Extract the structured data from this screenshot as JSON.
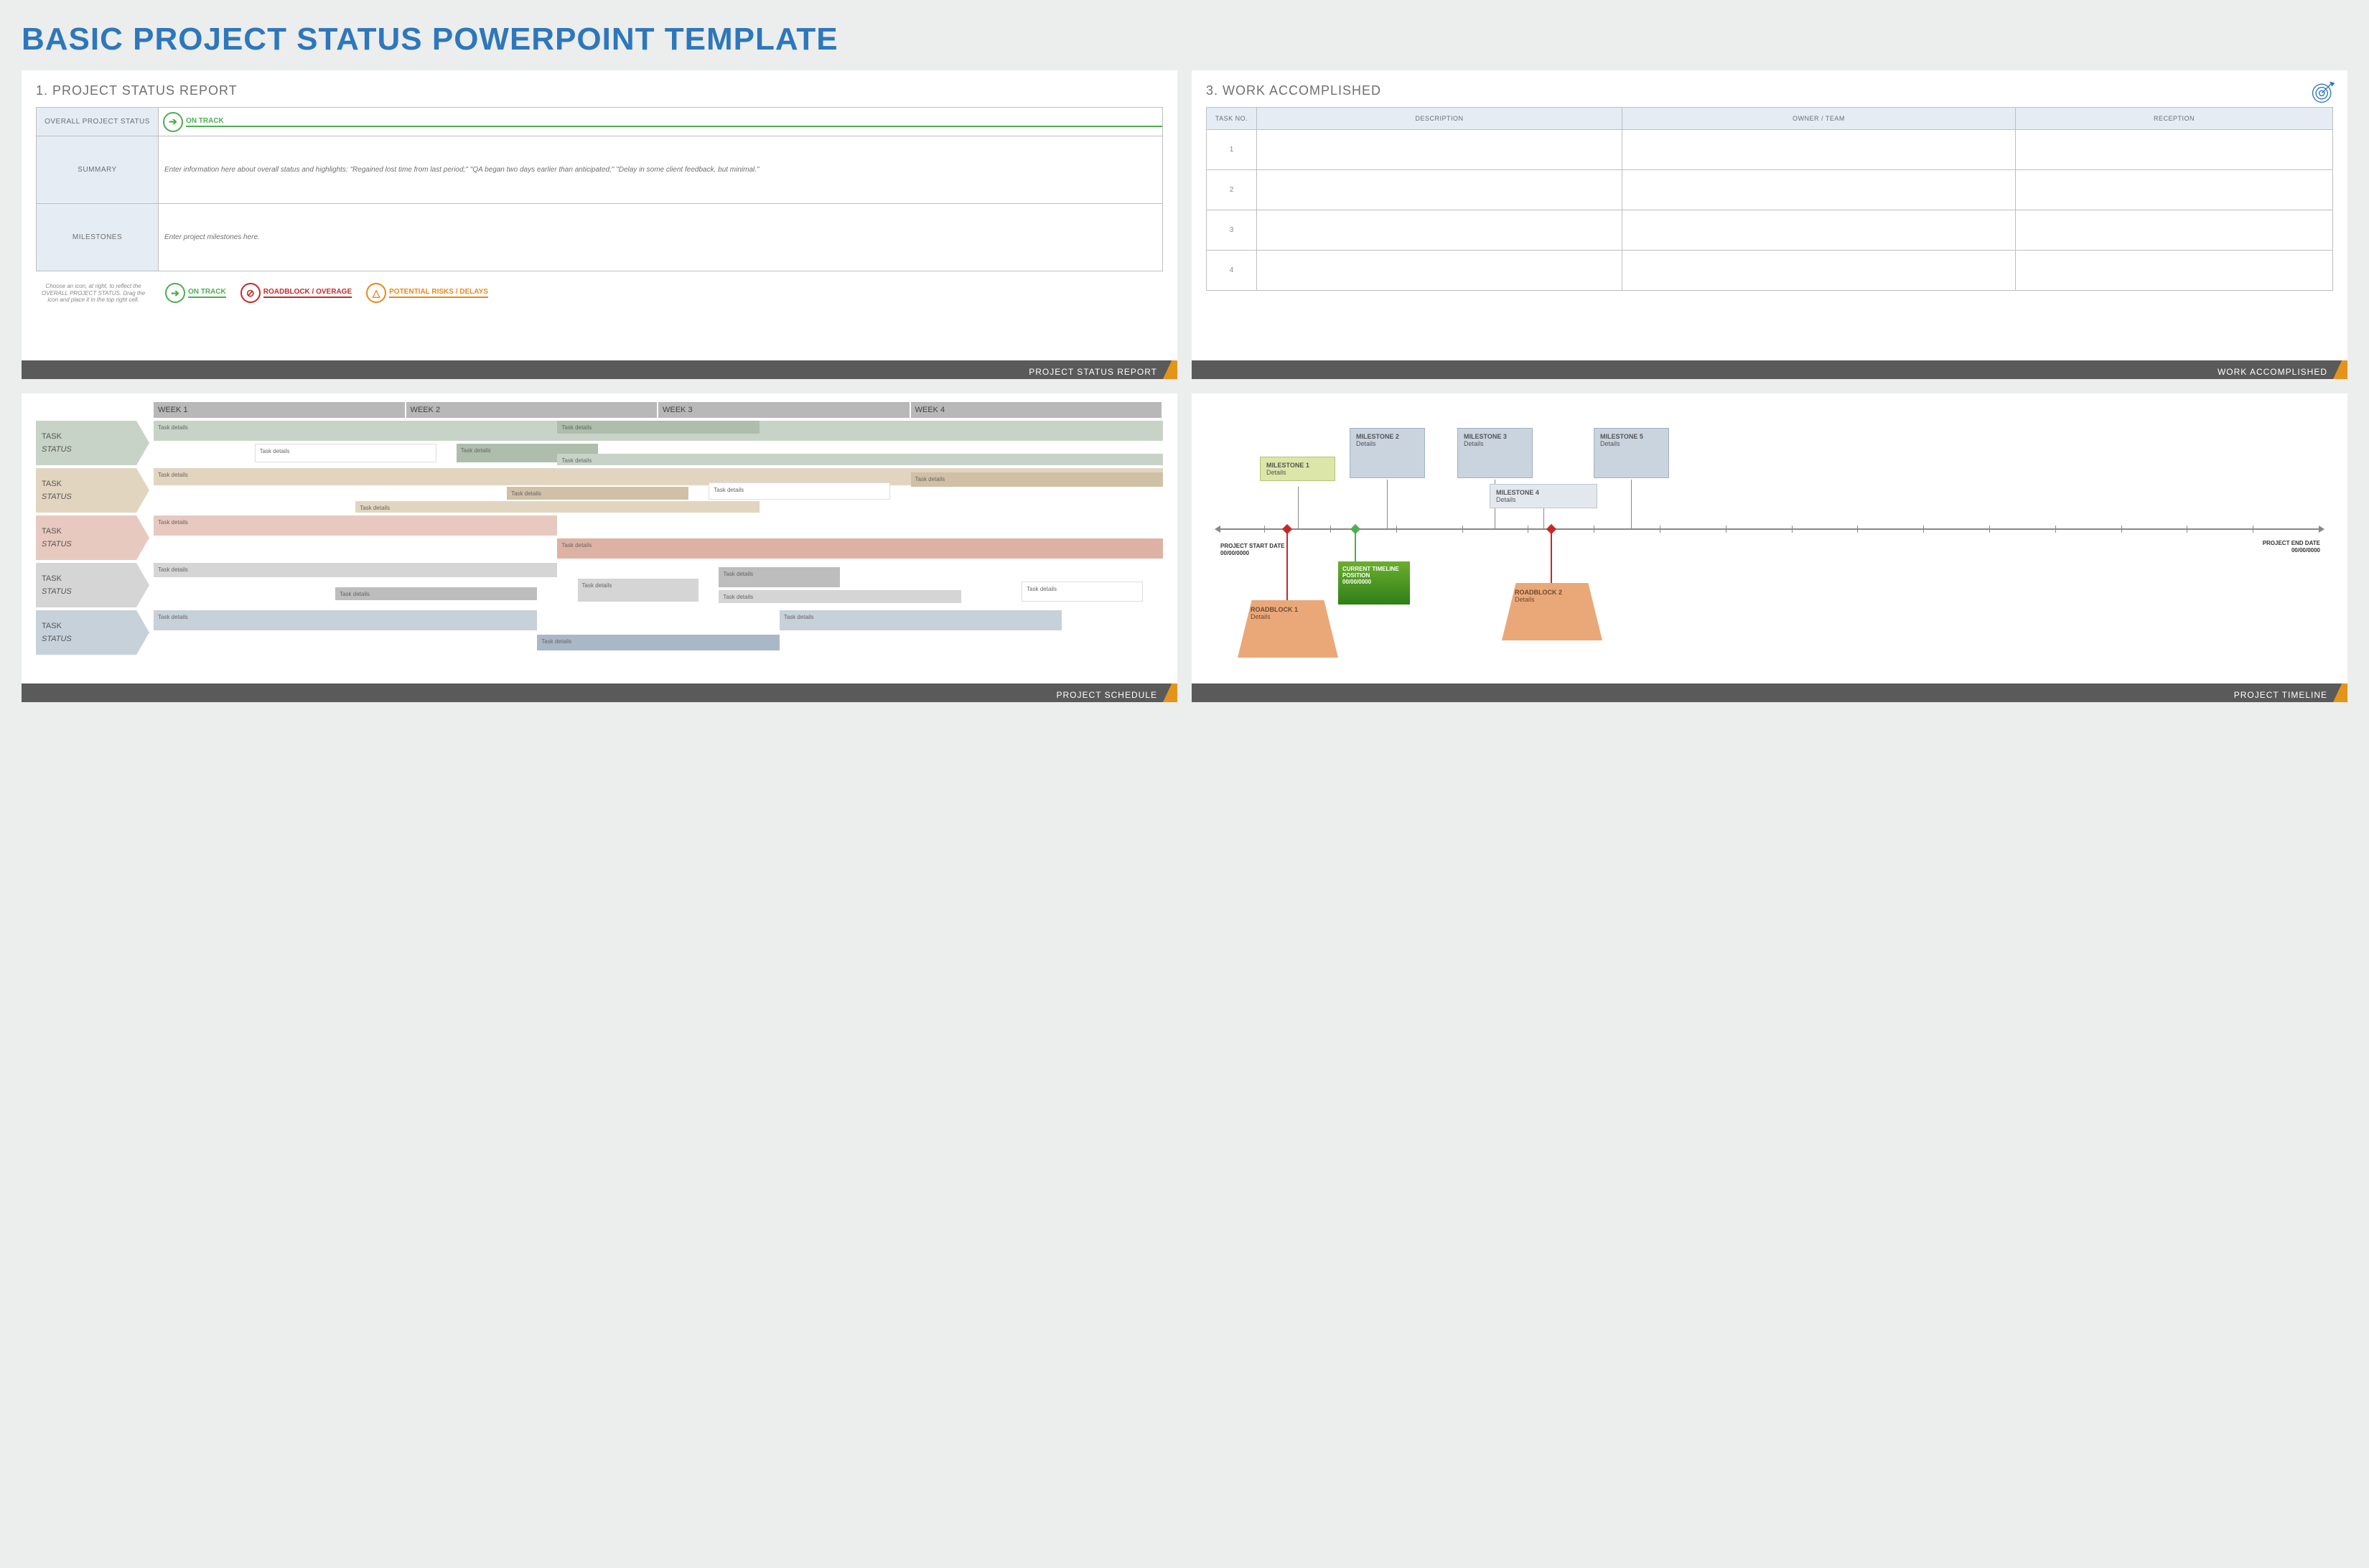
{
  "title": "BASIC PROJECT STATUS POWERPOINT TEMPLATE",
  "slide1": {
    "heading": "1. PROJECT STATUS REPORT",
    "footer": "PROJECT STATUS REPORT",
    "rows": {
      "overall_label": "OVERALL PROJECT STATUS",
      "summary_label": "SUMMARY",
      "summary_text": "Enter information here about overall status and highlights: \"Regained lost time from last period;\" \"QA began two days earlier than anticipated;\" \"Delay in some client feedback, but minimal.\"",
      "milestones_label": "MILESTONES",
      "milestones_text": "Enter project milestones here."
    },
    "legend_hint": "Choose an icon, at right, to reflect the OVERALL PROJECT STATUS. Drag the icon and place it in the top right cell.",
    "status": {
      "on_track": "ON TRACK",
      "roadblock": "ROADBLOCK / OVERAGE",
      "risks": "POTENTIAL RISKS / DELAYS"
    }
  },
  "slide3": {
    "heading": "3. WORK ACCOMPLISHED",
    "footer": "WORK ACCOMPLISHED",
    "columns": [
      "TASK NO.",
      "DESCRIPTION",
      "OWNER / TEAM",
      "RECEPTION"
    ],
    "rows": [
      "1",
      "2",
      "3",
      "4"
    ]
  },
  "schedule": {
    "footer": "PROJECT SCHEDULE",
    "weeks": [
      "WEEK 1",
      "WEEK 2",
      "WEEK 3",
      "WEEK 4"
    ],
    "task_label": "TASK",
    "status_label": "STATUS",
    "cell_text": "Task details"
  },
  "timeline": {
    "footer": "PROJECT TIMELINE",
    "start_label": "PROJECT START DATE",
    "start_date": "00/00/0000",
    "end_label": "PROJECT END DATE",
    "end_date": "00/00/0000",
    "current_label": "CURRENT TIMELINE POSITION",
    "current_date": "00/00/0000",
    "milestones": [
      {
        "title": "MILESTONE 1",
        "sub": "Details"
      },
      {
        "title": "MILESTONE 2",
        "sub": "Details"
      },
      {
        "title": "MILESTONE 3",
        "sub": "Details"
      },
      {
        "title": "MILESTONE 4",
        "sub": "Details"
      },
      {
        "title": "MILESTONE 5",
        "sub": "Details"
      }
    ],
    "roadblocks": [
      {
        "title": "ROADBLOCK 1",
        "sub": "Details"
      },
      {
        "title": "ROADBLOCK 2",
        "sub": "Details"
      }
    ]
  }
}
